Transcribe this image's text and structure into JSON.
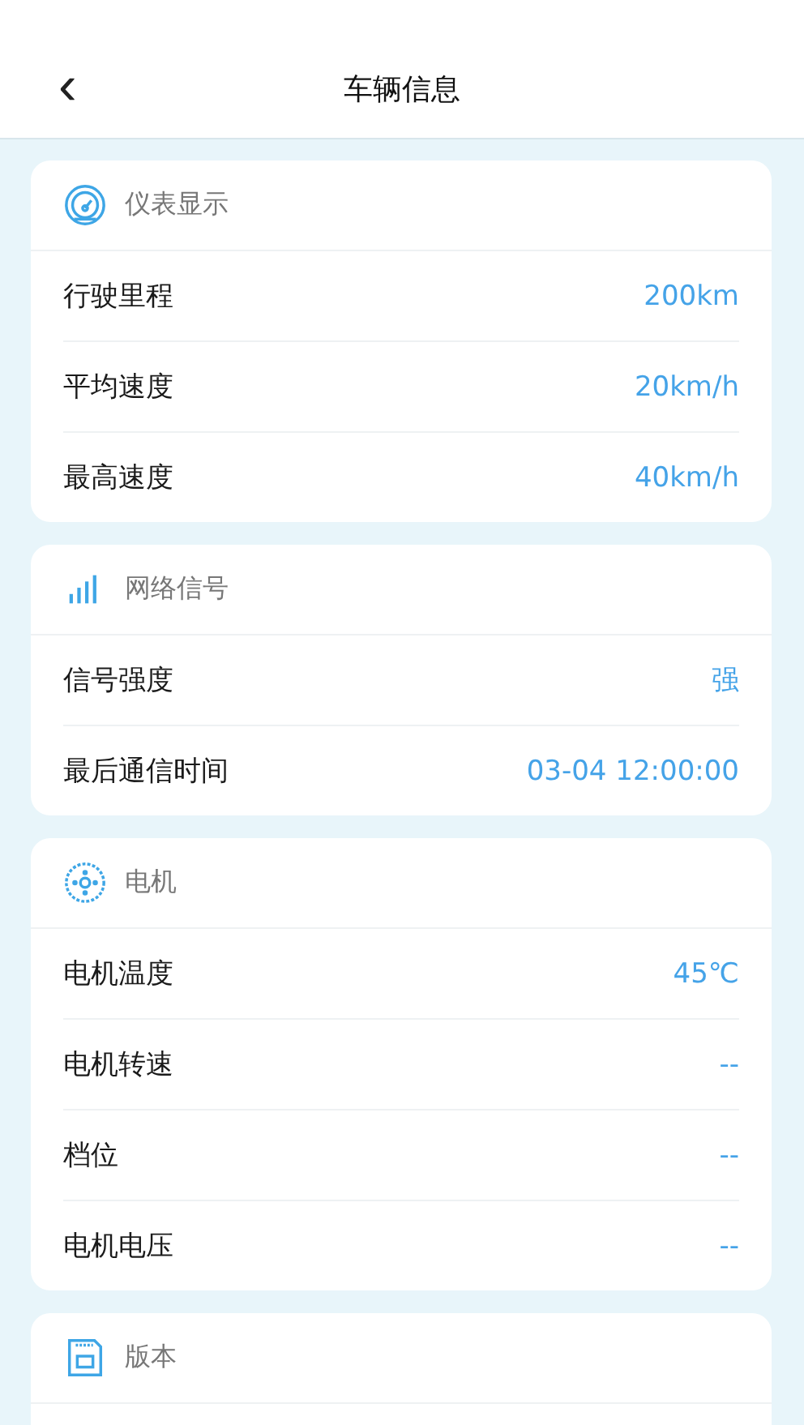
{
  "header": {
    "back_glyph": "‹",
    "title": "车辆信息"
  },
  "sections": [
    {
      "kind": "gauge",
      "title": "仪表显示",
      "rows": [
        {
          "label": "行驶里程",
          "value": "200km"
        },
        {
          "label": "平均速度",
          "value": "20km/h"
        },
        {
          "label": "最高速度",
          "value": "40km/h"
        }
      ]
    },
    {
      "kind": "signal",
      "title": "网络信号",
      "rows": [
        {
          "label": "信号强度",
          "value": "强"
        },
        {
          "label": "最后通信时间",
          "value": "03-04 12:00:00"
        }
      ]
    },
    {
      "kind": "motor",
      "title": "电机",
      "rows": [
        {
          "label": "电机温度",
          "value": "45℃"
        },
        {
          "label": "电机转速",
          "value": "--"
        },
        {
          "label": "档位",
          "value": "--"
        },
        {
          "label": "电机电压",
          "value": "--"
        }
      ]
    },
    {
      "kind": "card",
      "title": "版本"
    }
  ]
}
